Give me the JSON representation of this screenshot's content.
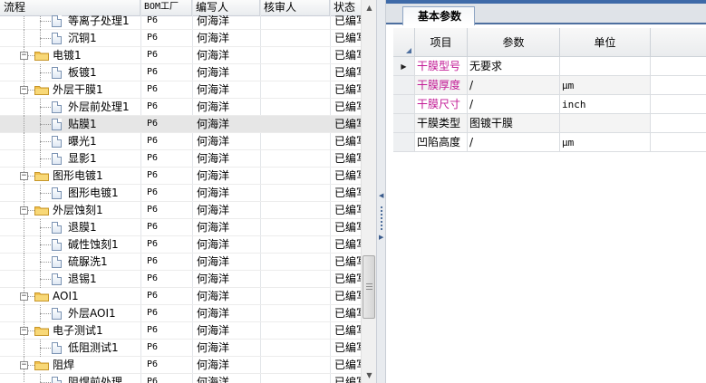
{
  "tree": {
    "columns": {
      "flow": "流程",
      "bom": "BOM工厂",
      "writer": "编写人",
      "reviewer": "核审人",
      "status": "状态"
    },
    "rows": [
      {
        "label": "等离子处理1",
        "kind": "doc",
        "level": 1,
        "bom": "P6",
        "writer": "何海洋",
        "reviewer": "",
        "status": "已编写"
      },
      {
        "label": "沉铜1",
        "kind": "doc",
        "level": 1,
        "bom": "P6",
        "writer": "何海洋",
        "reviewer": "",
        "status": "已编写"
      },
      {
        "label": "电镀1",
        "kind": "folder",
        "level": 0,
        "bom": "P6",
        "writer": "何海洋",
        "reviewer": "",
        "status": "已编写"
      },
      {
        "label": "板镀1",
        "kind": "doc",
        "level": 1,
        "bom": "P6",
        "writer": "何海洋",
        "reviewer": "",
        "status": "已编写"
      },
      {
        "label": "外层干膜1",
        "kind": "folder",
        "level": 0,
        "bom": "P6",
        "writer": "何海洋",
        "reviewer": "",
        "status": "已编写"
      },
      {
        "label": "外层前处理1",
        "kind": "doc",
        "level": 1,
        "bom": "P6",
        "writer": "何海洋",
        "reviewer": "",
        "status": "已编写"
      },
      {
        "label": "贴膜1",
        "kind": "doc",
        "level": 1,
        "bom": "P6",
        "writer": "何海洋",
        "reviewer": "",
        "status": "已编写",
        "selected": true
      },
      {
        "label": "曝光1",
        "kind": "doc",
        "level": 1,
        "bom": "P6",
        "writer": "何海洋",
        "reviewer": "",
        "status": "已编写"
      },
      {
        "label": "显影1",
        "kind": "doc",
        "level": 1,
        "bom": "P6",
        "writer": "何海洋",
        "reviewer": "",
        "status": "已编写"
      },
      {
        "label": "图形电镀1",
        "kind": "folder",
        "level": 0,
        "bom": "P6",
        "writer": "何海洋",
        "reviewer": "",
        "status": "已编写"
      },
      {
        "label": "图形电镀1",
        "kind": "doc",
        "level": 1,
        "bom": "P6",
        "writer": "何海洋",
        "reviewer": "",
        "status": "已编写"
      },
      {
        "label": "外层蚀刻1",
        "kind": "folder",
        "level": 0,
        "bom": "P6",
        "writer": "何海洋",
        "reviewer": "",
        "status": "已编写"
      },
      {
        "label": "退膜1",
        "kind": "doc",
        "level": 1,
        "bom": "P6",
        "writer": "何海洋",
        "reviewer": "",
        "status": "已编写"
      },
      {
        "label": "碱性蚀刻1",
        "kind": "doc",
        "level": 1,
        "bom": "P6",
        "writer": "何海洋",
        "reviewer": "",
        "status": "已编写"
      },
      {
        "label": "硫脲洗1",
        "kind": "doc",
        "level": 1,
        "bom": "P6",
        "writer": "何海洋",
        "reviewer": "",
        "status": "已编写"
      },
      {
        "label": "退锡1",
        "kind": "doc",
        "level": 1,
        "bom": "P6",
        "writer": "何海洋",
        "reviewer": "",
        "status": "已编写"
      },
      {
        "label": "AOI1",
        "kind": "folder",
        "level": 0,
        "bom": "P6",
        "writer": "何海洋",
        "reviewer": "",
        "status": "已编写"
      },
      {
        "label": "外层AOI1",
        "kind": "doc",
        "level": 1,
        "bom": "P6",
        "writer": "何海洋",
        "reviewer": "",
        "status": "已编写"
      },
      {
        "label": "电子测试1",
        "kind": "folder",
        "level": 0,
        "bom": "P6",
        "writer": "何海洋",
        "reviewer": "",
        "status": "已编写"
      },
      {
        "label": "低阻测试1",
        "kind": "doc",
        "level": 1,
        "bom": "P6",
        "writer": "何海洋",
        "reviewer": "",
        "status": "已编写"
      },
      {
        "label": "阻焊",
        "kind": "folder",
        "level": 0,
        "bom": "P6",
        "writer": "何海洋",
        "reviewer": "",
        "status": "已编写"
      },
      {
        "label": "阻焊前处理",
        "kind": "doc",
        "level": 1,
        "bom": "P6",
        "writer": "何海洋",
        "reviewer": "",
        "status": "已编写"
      }
    ]
  },
  "panel": {
    "tab_label": "基本参数",
    "headers": {
      "item": "项目",
      "param": "参数",
      "unit": "单位"
    },
    "rows": [
      {
        "item": "干膜型号",
        "value": "无要求",
        "unit": "",
        "highlight": true,
        "current": true
      },
      {
        "item": "干膜厚度",
        "value": "/",
        "unit": "μm",
        "highlight": true
      },
      {
        "item": "干膜尺寸",
        "value": "/",
        "unit": "inch",
        "highlight": true
      },
      {
        "item": "干膜类型",
        "value": "图镀干膜",
        "unit": "",
        "highlight": false
      },
      {
        "item": "凹陷高度",
        "value": "/",
        "unit": "μm",
        "highlight": false
      }
    ]
  },
  "colors": {
    "accent": "#3e6aa8",
    "highlight_text": "#c21a95",
    "folder": "#f2c14e",
    "selected_row": "#e6e6e6"
  },
  "icons": {
    "folder": "folder-icon",
    "document": "document-icon",
    "expand": "collapse-icon",
    "current_row": "row-pointer-icon"
  }
}
